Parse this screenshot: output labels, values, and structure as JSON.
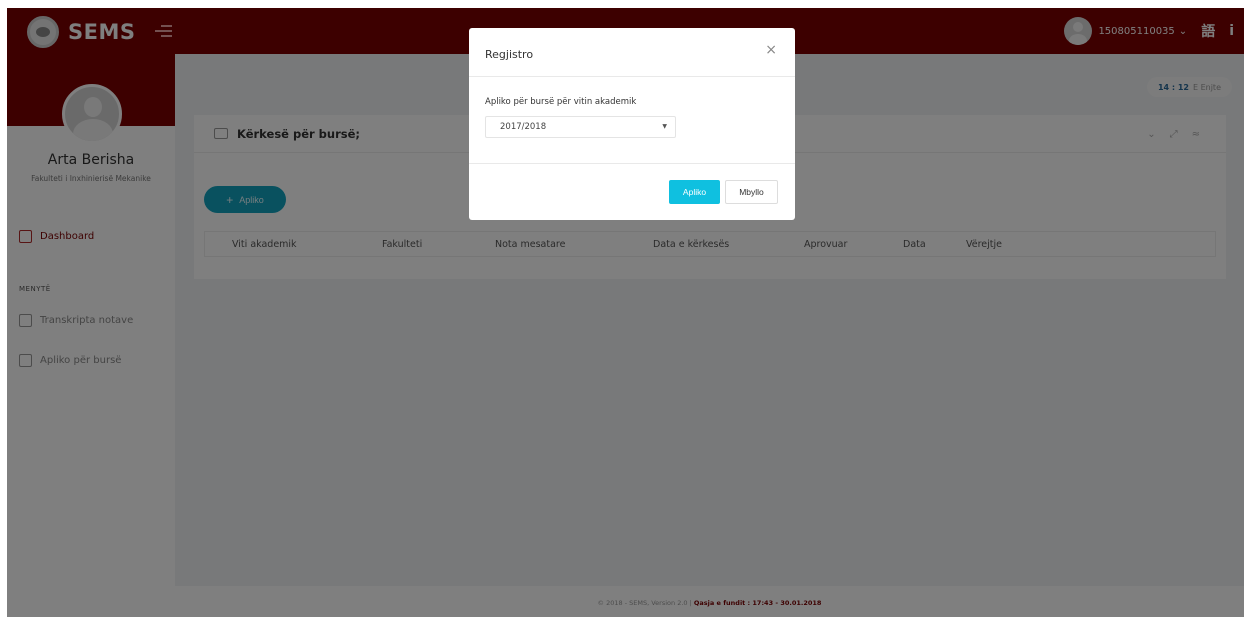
{
  "topbar": {
    "brand": "SEMS",
    "user_id": "150805110035",
    "chevron": "chevron-down-icon",
    "icons": [
      "language-icon",
      "info-icon"
    ]
  },
  "sidebar": {
    "profile_name": "Arta Berisha",
    "faculty": "Fakulteti i Inxhinierisë Mekanike",
    "dashboard_label": "Dashboard",
    "menu_label": "MENYTË",
    "items": [
      {
        "label": "Transkripta notave",
        "icon": "list-icon"
      },
      {
        "label": "Apliko për bursë",
        "icon": "edit-document-icon"
      }
    ]
  },
  "main": {
    "clock_time": "14 : 12",
    "clock_day": "E Enjte",
    "card_title": "Kërkesë për bursë;",
    "apply_label": "Apliko",
    "columns": [
      "Viti akademik",
      "Fakulteti",
      "Nota mesatare",
      "Data e kërkesës",
      "Aprovuar",
      "Data",
      "Vërejtje"
    ]
  },
  "footer": {
    "text": "© 2018 - SEMS, Version 2.0 | ",
    "highlight": "Qasja e fundit : 17:43 - 30.01.2018"
  },
  "modal": {
    "title": "Regjistro",
    "close_glyph": "×",
    "label": "Apliko për bursë për vitin akademik",
    "selected": "2017/2018",
    "apply_btn": "Apliko",
    "close_btn": "Mbyllo"
  },
  "colors": {
    "brand": "#7a0000",
    "accent": "#0fc0e0"
  }
}
